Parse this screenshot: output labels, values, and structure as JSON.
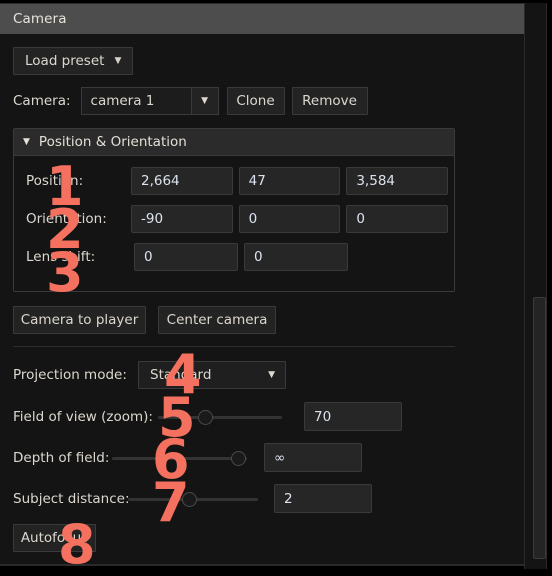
{
  "window": {
    "title": "Camera"
  },
  "toolbar": {
    "load_preset_label": "Load preset",
    "dropdown_caret": "▼"
  },
  "camera_row": {
    "label": "Camera:",
    "selected_camera": "camera 1",
    "dropdown_caret": "▼",
    "clone_label": "Clone",
    "remove_label": "Remove"
  },
  "position_group": {
    "expand_caret": "▼",
    "title": "Position & Orientation",
    "rows": [
      {
        "label": "Position:",
        "values": [
          "2,664",
          "47",
          "3,584"
        ]
      },
      {
        "label": "Orientation:",
        "values": [
          "-90",
          "0",
          "0"
        ]
      },
      {
        "label": "Lens shift:",
        "values": [
          "0",
          "0"
        ]
      }
    ]
  },
  "camera_actions": {
    "camera_to_player_label": "Camera to player",
    "center_camera_label": "Center camera"
  },
  "projection": {
    "label": "Projection mode:",
    "selected": "Standard",
    "caret": "▼"
  },
  "field_of_view": {
    "label": "Field of view (zoom):",
    "value": "70",
    "slider_fraction": 0.38
  },
  "depth_of_field": {
    "label": "Depth of field:",
    "value": "∞",
    "slider_fraction": 0.96
  },
  "subject_distance": {
    "label": "Subject distance:",
    "value": "2",
    "slider_fraction": 0.47
  },
  "autofocus": {
    "label": "Autofocus"
  },
  "annotations": {
    "color": "#f4705f",
    "items": [
      {
        "number": "1"
      },
      {
        "number": "2"
      },
      {
        "number": "3"
      },
      {
        "number": "4"
      },
      {
        "number": "5"
      },
      {
        "number": "6"
      },
      {
        "number": "7"
      },
      {
        "number": "8"
      }
    ]
  }
}
